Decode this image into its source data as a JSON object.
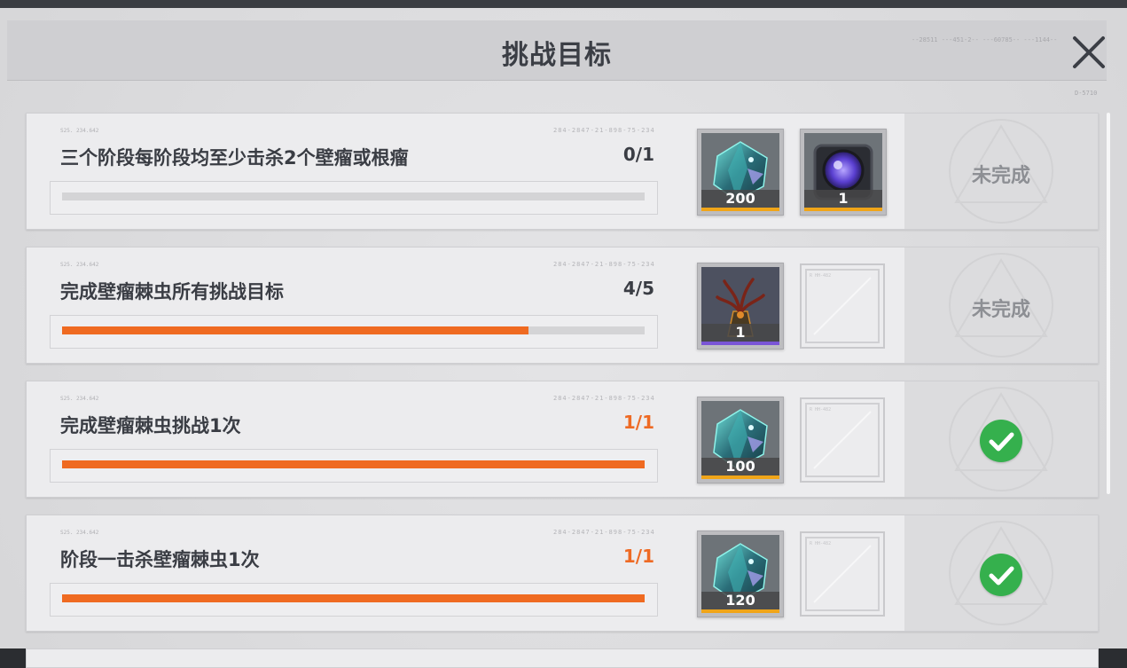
{
  "header": {
    "title": "挑战目标",
    "deco_right": "--28511 ---451-2-- ---60785-- ---1144--",
    "panel_code": "D-5710"
  },
  "colors": {
    "accent_orange": "#ef6a21",
    "complete_green": "#35b04d",
    "rarity_gold": "#f0a518",
    "rarity_purple": "#7a55d6"
  },
  "objectives": [
    {
      "code_left": "S25. 234.642",
      "code_right": "284-2847-21-898-75-234",
      "name": "三个阶段每阶段均至少击杀2个壁瘤或根瘤",
      "progress_text": "0/1",
      "progress": 0,
      "rewards": [
        {
          "icon": "crystal-icon",
          "qty": "200",
          "rarity": "gold"
        },
        {
          "icon": "purple-core-icon",
          "qty": "1",
          "rarity": "gold"
        }
      ],
      "status": "未完成",
      "completed": false
    },
    {
      "code_left": "S25. 234.642",
      "code_right": "284-2847-21-898-75-234",
      "name": "完成壁瘤棘虫所有挑战目标",
      "progress_text": "4/5",
      "progress": 0.8,
      "rewards": [
        {
          "icon": "tendril-trophy-icon",
          "qty": "1",
          "rarity": "purple"
        },
        {
          "icon": "empty-slot",
          "empty_code": "R HH-482"
        }
      ],
      "status": "未完成",
      "completed": false
    },
    {
      "code_left": "S25. 234.642",
      "code_right": "284-2847-21-898-75-234",
      "name": "完成壁瘤棘虫挑战1次",
      "progress_text": "1/1",
      "progress": 1,
      "rewards": [
        {
          "icon": "crystal-icon",
          "qty": "100",
          "rarity": "gold"
        },
        {
          "icon": "empty-slot",
          "empty_code": "R HH-482"
        }
      ],
      "status": "",
      "completed": true
    },
    {
      "code_left": "S25. 234.642",
      "code_right": "284-2847-21-898-75-234",
      "name": "阶段一击杀壁瘤棘虫1次",
      "progress_text": "1/1",
      "progress": 1,
      "rewards": [
        {
          "icon": "crystal-icon",
          "qty": "120",
          "rarity": "gold"
        },
        {
          "icon": "empty-slot",
          "empty_code": "R HH-482"
        }
      ],
      "status": "",
      "completed": true
    }
  ]
}
